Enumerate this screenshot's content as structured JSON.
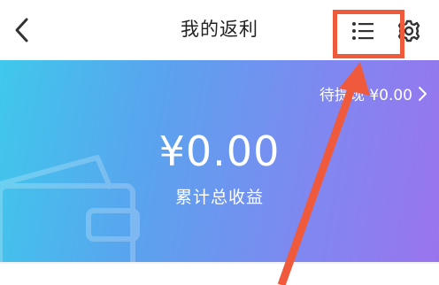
{
  "header": {
    "title": "我的返利",
    "back_icon": "chevron-left-icon",
    "list_icon": "list-icon",
    "settings_icon": "gear-icon"
  },
  "banner": {
    "pending_label": "待提现 ¥0.00",
    "amount": "¥0.00",
    "total_label": "累计总收益",
    "gradient_colors": [
      "#3fc8ec",
      "#5aa3ee",
      "#7f88f0",
      "#9a74ee"
    ]
  },
  "annotation": {
    "color": "#f05a3c"
  }
}
